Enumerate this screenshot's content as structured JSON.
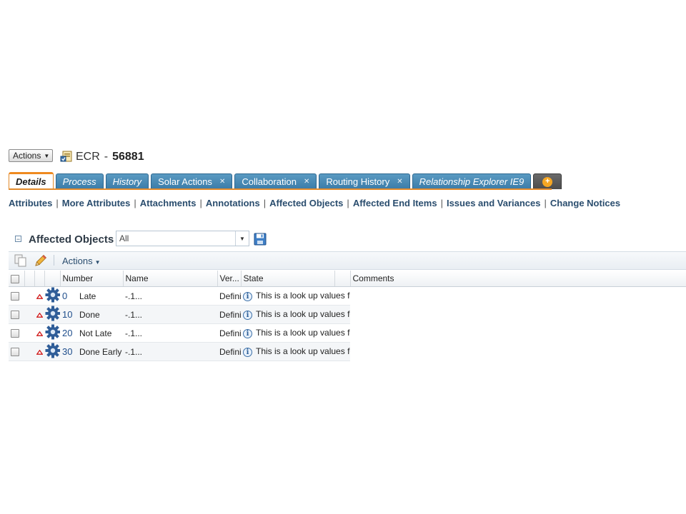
{
  "header": {
    "actions_label": "Actions",
    "object_type": "ECR",
    "separator": "-",
    "object_number": "56881"
  },
  "tabs": [
    {
      "label": "Details",
      "active": true
    },
    {
      "label": "Process"
    },
    {
      "label": "History"
    },
    {
      "label": "Solar Actions",
      "closable": true
    },
    {
      "label": "Collaboration",
      "closable": true
    },
    {
      "label": "Routing History",
      "closable": true
    },
    {
      "label": "Relationship Explorer IE9"
    }
  ],
  "subnav": [
    "Attributes",
    "More Attributes",
    "Attachments",
    "Annotations",
    "Affected Objects",
    "Affected End Items",
    "Issues and Variances",
    "Change Notices"
  ],
  "section": {
    "title": "Affected Objects",
    "filter_value": "All"
  },
  "toolbar": {
    "actions_label": "Actions"
  },
  "table": {
    "columns": {
      "number": "Number",
      "name": "Name",
      "version": "Ver...",
      "state": "State",
      "comments": "Comments"
    },
    "rows": [
      {
        "number": "0",
        "name": "Late",
        "version": "-.1...",
        "state": "Definition Complete",
        "comment": "This is a look up values for our status reports.  Do not use, change, or delete this part."
      },
      {
        "number": "10",
        "name": "Done",
        "version": "-.1...",
        "state": "Definition Complete",
        "comment": "This is a look up values for our status reports.  Do not use, change, or delete this part."
      },
      {
        "number": "20",
        "name": "Not Late",
        "version": "-.1...",
        "state": "Definition Complete",
        "comment": "This is a look up values for our status reports.  Do not use, change, or delete this part."
      },
      {
        "number": "30",
        "name": "Done Early",
        "version": "-.1...",
        "state": "Definition Complete",
        "comment": "This is a look up values for our status reports.  Do not use, change, or delete this part."
      }
    ]
  },
  "colors": {
    "tab_blue": "#3b7ca8",
    "tab_active_accent": "#ef8a1f",
    "link_blue": "#2a4d6e"
  }
}
